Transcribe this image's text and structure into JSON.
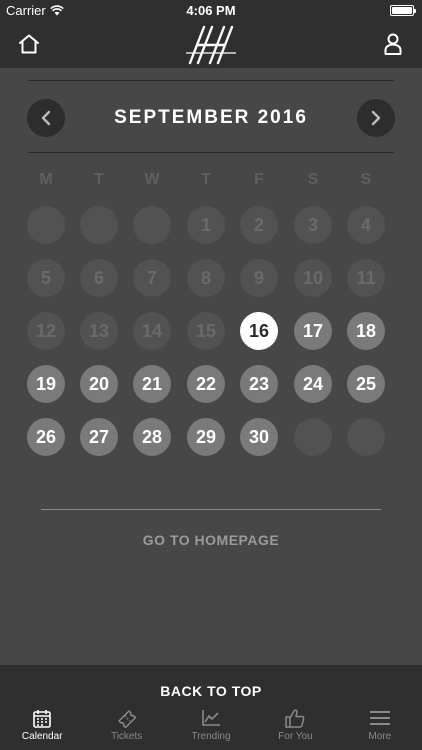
{
  "status_bar": {
    "carrier": "Carrier",
    "time": "4:06 PM"
  },
  "nav": {
    "home_icon": "home-icon",
    "user_icon": "user-icon",
    "logo_icon": "h-logo-icon"
  },
  "calendar": {
    "month_title": "SEPTEMBER 2016",
    "weekdays": [
      "M",
      "T",
      "W",
      "T",
      "F",
      "S",
      "S"
    ],
    "today": 16,
    "weeks": [
      [
        null,
        null,
        null,
        1,
        2,
        3,
        4
      ],
      [
        5,
        6,
        7,
        8,
        9,
        10,
        11
      ],
      [
        12,
        13,
        14,
        15,
        16,
        17,
        18
      ],
      [
        19,
        20,
        21,
        22,
        23,
        24,
        25
      ],
      [
        26,
        27,
        28,
        29,
        30,
        null,
        null
      ]
    ]
  },
  "links": {
    "go_to_homepage": "GO TO HOMEPAGE",
    "back_to_top": "BACK TO TOP"
  },
  "tabs": [
    {
      "label": "Calendar",
      "icon": "calendar-icon",
      "active": true
    },
    {
      "label": "Tickets",
      "icon": "ticket-icon",
      "active": false
    },
    {
      "label": "Trending",
      "icon": "trending-icon",
      "active": false
    },
    {
      "label": "For You",
      "icon": "thumbs-up-icon",
      "active": false
    },
    {
      "label": "More",
      "icon": "menu-icon",
      "active": false
    }
  ],
  "colors": {
    "background": "#474747",
    "bar": "#2f2f2f",
    "past_day": "#525252",
    "future_day": "#7a7a7a",
    "today": "#ffffff"
  }
}
